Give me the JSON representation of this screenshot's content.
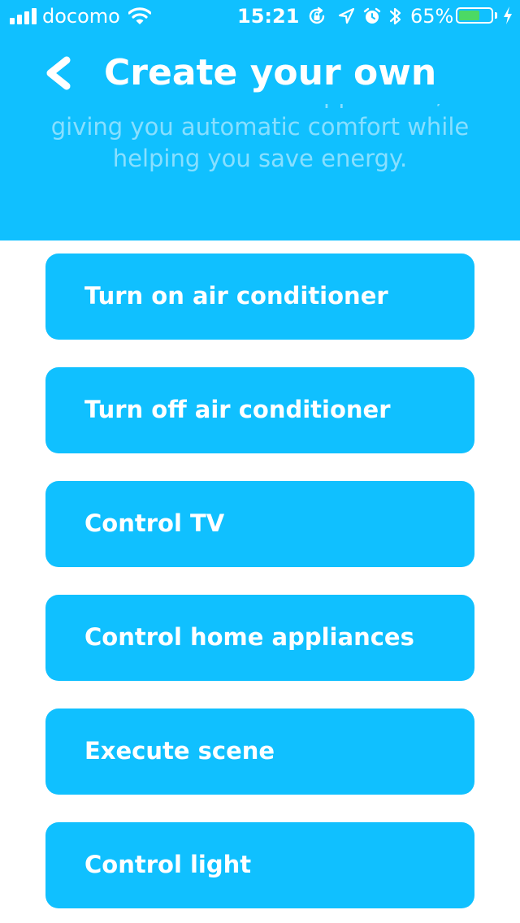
{
  "status_bar": {
    "carrier": "docomo",
    "time": "15:21",
    "battery_percent": "65%",
    "battery_level": 0.65,
    "battery_color": "#4cd964",
    "icons": [
      "signal-icon",
      "wifi-icon",
      "rotation-lock-icon",
      "location-icon",
      "alarm-icon",
      "bluetooth-icon",
      "battery-icon",
      "charging-icon"
    ]
  },
  "header": {
    "title": "Create your own",
    "back_icon": "chevron-left-icon",
    "description_line_1": "and audio to smart appliances,",
    "description_line_2": "giving you automatic comfort while",
    "description_line_3": "helping you save energy."
  },
  "actions": [
    {
      "label": "Turn on air conditioner"
    },
    {
      "label": "Turn off air conditioner"
    },
    {
      "label": "Control TV"
    },
    {
      "label": "Control home appliances"
    },
    {
      "label": "Execute scene"
    },
    {
      "label": "Control light"
    }
  ],
  "colors": {
    "accent": "#10c0ff",
    "text": "#ffffff",
    "background": "#ffffff"
  }
}
